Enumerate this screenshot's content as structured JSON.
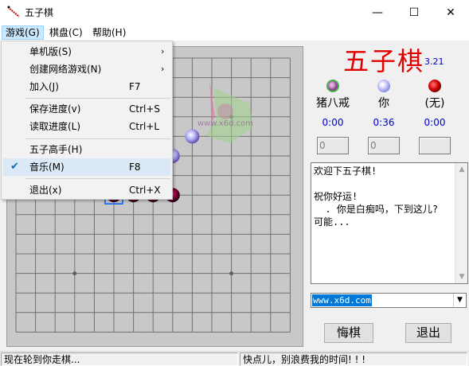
{
  "window": {
    "title": "五子棋",
    "min_glyph": "—",
    "max_glyph": "☐",
    "close_glyph": "✕"
  },
  "menubar": {
    "game": "游戏(G)",
    "board": "棋盘(C)",
    "help": "帮助(H)"
  },
  "game_menu": {
    "items": [
      {
        "label": "单机版(S)",
        "shortcut": "",
        "arrow": "›"
      },
      {
        "label": "创建网络游戏(N)",
        "shortcut": "",
        "arrow": "›"
      },
      {
        "label": "加入(J)",
        "shortcut": "F7",
        "arrow": ""
      },
      {
        "label": "保存进度(v)",
        "shortcut": "Ctrl+S",
        "arrow": ""
      },
      {
        "label": "读取进度(L)",
        "shortcut": "Ctrl+L",
        "arrow": ""
      },
      {
        "label": "五子高手(H)",
        "shortcut": "",
        "arrow": ""
      },
      {
        "label": "音乐(M)",
        "shortcut": "F8",
        "arrow": "",
        "checked": true,
        "check_glyph": "✔"
      },
      {
        "label": "退出(x)",
        "shortcut": "Ctrl+X",
        "arrow": ""
      }
    ]
  },
  "header": {
    "game_title": "五子棋",
    "version": "3.21"
  },
  "players": [
    {
      "name": "猪八戒",
      "time": "0:00",
      "score": "0",
      "stone_color": "#4caf50"
    },
    {
      "name": "你",
      "time": "0:36",
      "score": "0",
      "stone_color": "#a9a9f0"
    },
    {
      "name": "(无)",
      "time": "0:00",
      "score": "",
      "stone_color": "#cc0000"
    }
  ],
  "chat": {
    "text": "欢迎下五子棋!\n\n祝你好运!\n  . 你是白痴吗，下到这儿?\n可能..."
  },
  "url_combo": {
    "value": "www.x6d.com"
  },
  "buttons": {
    "undo": "悔棋",
    "quit": "退出"
  },
  "status": {
    "left": "现在轮到你走棋...",
    "right": "快点儿，别浪费我的时间! ! !"
  },
  "board": {
    "size": 15,
    "stones": [
      {
        "col": 9,
        "row": 4,
        "color": "purple-white"
      },
      {
        "col": 8,
        "row": 5,
        "color": "purple-white"
      },
      {
        "col": 5,
        "row": 7,
        "color": "red-black"
      },
      {
        "col": 6,
        "row": 7,
        "color": "red-black"
      },
      {
        "col": 7,
        "row": 7,
        "color": "red-black"
      },
      {
        "col": 8,
        "row": 7,
        "color": "red-black"
      }
    ],
    "last_move": {
      "col": 5,
      "row": 7
    }
  },
  "watermark": {
    "text": "www.x6d.com"
  }
}
